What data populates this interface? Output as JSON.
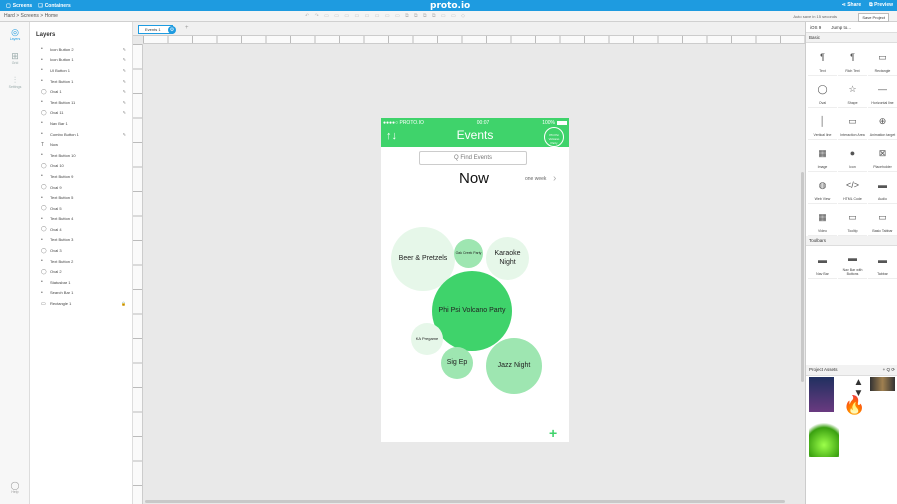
{
  "topbar": {
    "screens": "Screens",
    "containers": "Containers",
    "logo": "proto.io",
    "share": "Share",
    "preview": "Preview"
  },
  "toolbar": {
    "breadcrumb": "Hard > Screens > Home",
    "autosave": "Auto save in 15 seconds",
    "save_project": "Save Project"
  },
  "rail": {
    "layers": "Layers",
    "grid": "Grid",
    "settings": "Settings",
    "help": "Help"
  },
  "layers": {
    "title": "Layers",
    "items": [
      {
        "icon": "apple",
        "label": "Icon Button 2",
        "pinned": true
      },
      {
        "icon": "apple",
        "label": "Icon Button 1",
        "pinned": true
      },
      {
        "icon": "apple",
        "label": "UI Button 1",
        "pinned": true
      },
      {
        "icon": "apple",
        "label": "Text Button 1",
        "pinned": true
      },
      {
        "icon": "oval",
        "label": "Oval 1",
        "pinned": true
      },
      {
        "icon": "apple",
        "label": "Text Button 11",
        "pinned": true
      },
      {
        "icon": "oval",
        "label": "Oval 11",
        "pinned": true
      },
      {
        "icon": "apple",
        "label": "Nav Bar 1",
        "pinned": false
      },
      {
        "icon": "apple",
        "label": "Combo Button 1",
        "pinned": true
      },
      {
        "icon": "text",
        "label": "Now",
        "pinned": false
      },
      {
        "icon": "apple",
        "label": "Text Button 10",
        "pinned": false
      },
      {
        "icon": "oval",
        "label": "Oval 10",
        "pinned": false
      },
      {
        "icon": "apple",
        "label": "Text Button 9",
        "pinned": false
      },
      {
        "icon": "oval",
        "label": "Oval 9",
        "pinned": false
      },
      {
        "icon": "apple",
        "label": "Text Button 5",
        "pinned": false
      },
      {
        "icon": "oval",
        "label": "Oval 5",
        "pinned": false
      },
      {
        "icon": "apple",
        "label": "Text Button 4",
        "pinned": false
      },
      {
        "icon": "oval",
        "label": "Oval 4",
        "pinned": false
      },
      {
        "icon": "apple",
        "label": "Text Button 3",
        "pinned": false
      },
      {
        "icon": "oval",
        "label": "Oval 3",
        "pinned": false
      },
      {
        "icon": "apple",
        "label": "Text Button 2",
        "pinned": false
      },
      {
        "icon": "oval",
        "label": "Oval 2",
        "pinned": false
      },
      {
        "icon": "apple",
        "label": "Statusbar 1",
        "pinned": false
      },
      {
        "icon": "apple",
        "label": "Search Bar 1",
        "pinned": false
      },
      {
        "icon": "rect",
        "label": "Rectangle 1",
        "pinned": false,
        "locked": true
      }
    ]
  },
  "canvas": {
    "page_tab": "Events 1",
    "phone": {
      "carrier": "●●●●○ PROTO.IO",
      "time": "00:07",
      "battery": "100%",
      "title": "Events",
      "badge": "Phi Psi Volcano Party",
      "search_placeholder": "Q Find Events",
      "now": "Now",
      "range": "one week",
      "bubbles": [
        {
          "label": "Beer & Pretzels",
          "color": "#e6f7e9"
        },
        {
          "label": "Oak Creek Party",
          "color": "#9ee6b1"
        },
        {
          "label": "Karaoke Night",
          "color": "#e6f7e9"
        },
        {
          "label": "Phi Psi Volcano Party",
          "color": "#3fd36b"
        },
        {
          "label": "KA Pregame",
          "color": "#e6f7e9"
        },
        {
          "label": "Sig Ep",
          "color": "#9ee6b1"
        },
        {
          "label": "Jazz Night",
          "color": "#9ee6b1"
        }
      ]
    }
  },
  "rightpanel": {
    "platform": "iOS 9",
    "jump": "Jump to...",
    "section_basic": "Basic",
    "basic": [
      "Text",
      "Rich Text",
      "Rectangle",
      "Oval",
      "Shape",
      "Horizontal line",
      "Vertical line",
      "Interaction Area",
      "Animation target",
      "Image",
      "Icon",
      "Placeholder",
      "Web View",
      "HTML Code",
      "Audio",
      "Video",
      "Tooltip",
      "Basic Tabbar"
    ],
    "section_toolbars": "Toolbars",
    "toolbars": [
      "Nav Bar",
      "Nav Bar with Buttons",
      "Tabbar"
    ],
    "assets_title": "Project Assets"
  }
}
